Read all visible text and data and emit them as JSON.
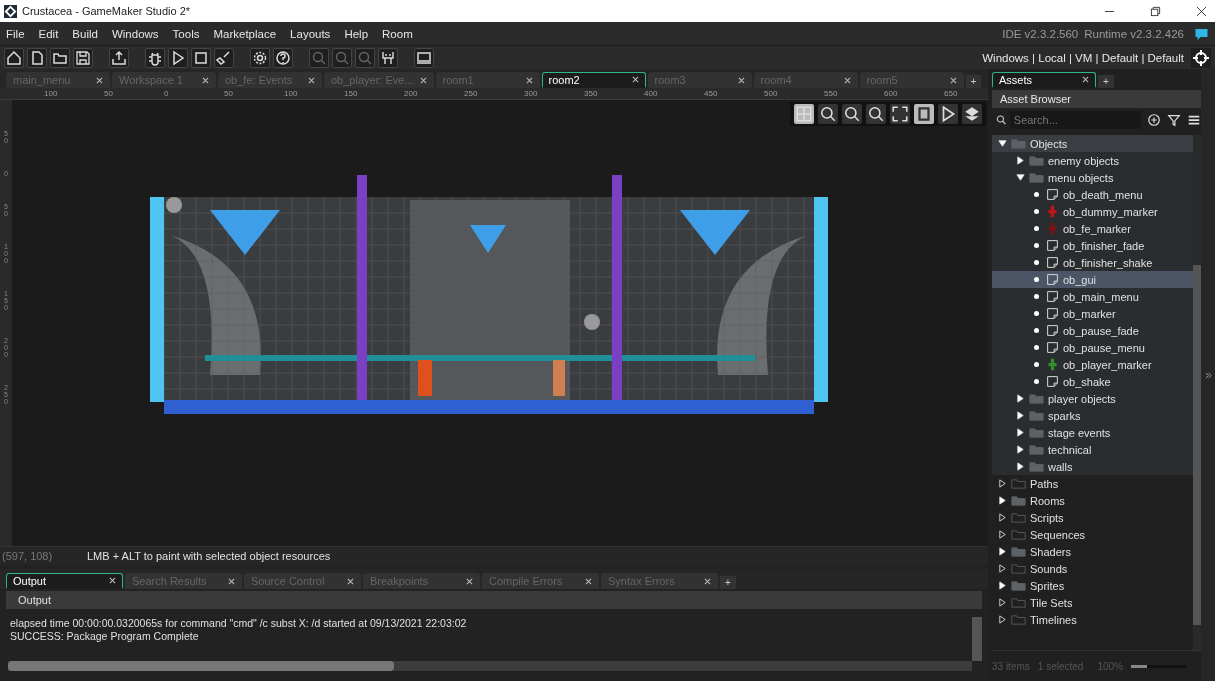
{
  "window": {
    "title": "Crustacea - GameMaker Studio 2*"
  },
  "menu": [
    "File",
    "Edit",
    "Build",
    "Windows",
    "Tools",
    "Marketplace",
    "Layouts",
    "Help",
    "Room"
  ],
  "version": {
    "ide": "IDE v2.3.2.560",
    "runtime": "Runtime v2.3.2.426"
  },
  "target": "Windows | Local | VM | Default | Default",
  "tabs": [
    {
      "label": "main_menu",
      "selected": false
    },
    {
      "label": "Workspace 1",
      "selected": false
    },
    {
      "label": "ob_fe: Events",
      "selected": false
    },
    {
      "label": "ob_player: Eve...",
      "selected": false
    },
    {
      "label": "room1",
      "selected": false
    },
    {
      "label": "room2",
      "selected": true
    },
    {
      "label": "room3",
      "selected": false
    },
    {
      "label": "room4",
      "selected": false
    },
    {
      "label": "room5",
      "selected": false
    }
  ],
  "add_tab": "+",
  "ruler": {
    "horizontal": [
      "100",
      "50",
      "0",
      "50",
      "100",
      "150",
      "200",
      "250",
      "300",
      "350",
      "400",
      "450",
      "500",
      "550",
      "600",
      "650"
    ],
    "vertical": [
      "50",
      "0",
      "50",
      "100",
      "150",
      "200",
      "250"
    ]
  },
  "status": {
    "coords": "(597, 108)",
    "hint": "LMB + ALT to paint with selected object resources"
  },
  "output_tabs": [
    {
      "label": "Output",
      "selected": true
    },
    {
      "label": "Search Results",
      "selected": false
    },
    {
      "label": "Source Control",
      "selected": false
    },
    {
      "label": "Breakpoints",
      "selected": false
    },
    {
      "label": "Compile Errors",
      "selected": false
    },
    {
      "label": "Syntax Errors",
      "selected": false
    }
  ],
  "output_add": "+",
  "output": {
    "header": "Output",
    "lines": [
      "elapsed time 00:00:00.0320065s for command \"cmd\" /c subst X: /d started at 09/13/2021 22:03:02",
      "SUCCESS: Package Program Complete"
    ]
  },
  "assets": {
    "tab": "Assets",
    "add_tab": "+",
    "title": "Asset Browser",
    "search_placeholder": "Search...",
    "tree": [
      {
        "kind": "folder",
        "label": "Objects",
        "expanded": true,
        "empty": false,
        "selected": false,
        "children": [
          {
            "kind": "folder",
            "label": "enemy objects",
            "expanded": false,
            "empty": false,
            "selected": false
          },
          {
            "kind": "folder",
            "label": "menu objects",
            "expanded": true,
            "empty": false,
            "selected": false,
            "children": [
              {
                "kind": "object",
                "label": "ob_death_menu",
                "selected": false
              },
              {
                "kind": "object",
                "label": "ob_dummy_marker",
                "color": "#c0141a",
                "selected": false
              },
              {
                "kind": "object",
                "label": "ob_fe_marker",
                "color": "#7a1414",
                "selected": false
              },
              {
                "kind": "object",
                "label": "ob_finisher_fade",
                "selected": false
              },
              {
                "kind": "object",
                "label": "ob_finisher_shake",
                "selected": false
              },
              {
                "kind": "object",
                "label": "ob_gui",
                "selected": true
              },
              {
                "kind": "object",
                "label": "ob_main_menu",
                "selected": false
              },
              {
                "kind": "object",
                "label": "ob_marker",
                "selected": false
              },
              {
                "kind": "object",
                "label": "ob_pause_fade",
                "selected": false
              },
              {
                "kind": "object",
                "label": "ob_pause_menu",
                "selected": false
              },
              {
                "kind": "object",
                "label": "ob_player_marker",
                "color": "#2f8f2a",
                "selected": false
              },
              {
                "kind": "object",
                "label": "ob_shake",
                "selected": false
              }
            ]
          },
          {
            "kind": "folder",
            "label": "player objects",
            "expanded": false,
            "empty": false,
            "selected": false
          },
          {
            "kind": "folder",
            "label": "sparks",
            "expanded": false,
            "empty": false,
            "selected": false
          },
          {
            "kind": "folder",
            "label": "stage events",
            "expanded": false,
            "empty": false,
            "selected": false
          },
          {
            "kind": "folder",
            "label": "technical",
            "expanded": false,
            "empty": false,
            "selected": false
          },
          {
            "kind": "folder",
            "label": "walls",
            "expanded": false,
            "empty": false,
            "selected": false
          }
        ]
      },
      {
        "kind": "folder",
        "label": "Paths",
        "expanded": false,
        "empty": true,
        "selected": false
      },
      {
        "kind": "folder",
        "label": "Rooms",
        "expanded": false,
        "empty": false,
        "selected": false
      },
      {
        "kind": "folder",
        "label": "Scripts",
        "expanded": false,
        "empty": true,
        "selected": false
      },
      {
        "kind": "folder",
        "label": "Sequences",
        "expanded": false,
        "empty": true,
        "selected": false
      },
      {
        "kind": "folder",
        "label": "Shaders",
        "expanded": false,
        "empty": false,
        "selected": false
      },
      {
        "kind": "folder",
        "label": "Sounds",
        "expanded": false,
        "empty": true,
        "selected": false
      },
      {
        "kind": "folder",
        "label": "Sprites",
        "expanded": false,
        "empty": false,
        "selected": false
      },
      {
        "kind": "folder",
        "label": "Tile Sets",
        "expanded": false,
        "empty": true,
        "selected": false
      },
      {
        "kind": "folder",
        "label": "Timelines",
        "expanded": false,
        "empty": true,
        "selected": false
      }
    ],
    "footer": {
      "count": "33 items",
      "selected": "1 selected",
      "zoom": "100%",
      "zoom_level": {
        "level": 0.3
      }
    }
  }
}
